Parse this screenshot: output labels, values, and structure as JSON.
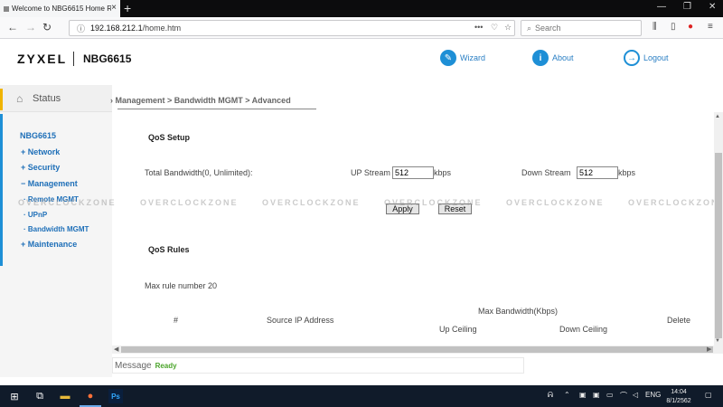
{
  "browser": {
    "tab_title": "Welcome to NBG6615 Home Ro",
    "url_host": "192.168.212.1",
    "url_path": "/home.htm",
    "search_placeholder": "Search"
  },
  "header": {
    "brand": "ZYXEL",
    "model": "NBG6615",
    "links": {
      "wizard": "Wizard",
      "about": "About",
      "logout": "Logout"
    }
  },
  "sidebar": {
    "status": "Status",
    "device": "NBG6615",
    "items": {
      "network": "+ Network",
      "security": "+ Security",
      "management": "− Management",
      "remote_mgmt": "· Remote MGMT",
      "upnp": "· UPnP",
      "bandwidth_mgmt": "· Bandwidth MGMT",
      "maintenance": "+ Maintenance"
    }
  },
  "breadcrumb": "Management > Bandwidth MGMT > Advanced",
  "qos_setup": {
    "title": "QoS Setup",
    "total_bandwidth_label": "Total Bandwidth(0, Unlimited):",
    "up_label": "UP Stream",
    "up_value": "512",
    "up_unit": "kbps",
    "down_label": "Down Stream",
    "down_value": "512",
    "down_unit": "kbps",
    "apply": "Apply",
    "reset": "Reset"
  },
  "qos_rules": {
    "title": "QoS Rules",
    "max_rule": "Max rule number 20",
    "columns": {
      "num": "#",
      "source_ip": "Source IP Address",
      "max_bandwidth": "Max Bandwidth(Kbps)",
      "up_ceiling": "Up Ceiling",
      "down_ceiling": "Down Ceiling",
      "delete": "Delete"
    }
  },
  "watermark": "OVERCLOCKZONE",
  "message": {
    "label": "Message",
    "value": "Ready"
  },
  "taskbar": {
    "lang": "ENG",
    "time": "14:04",
    "date": "8/1/2562"
  }
}
